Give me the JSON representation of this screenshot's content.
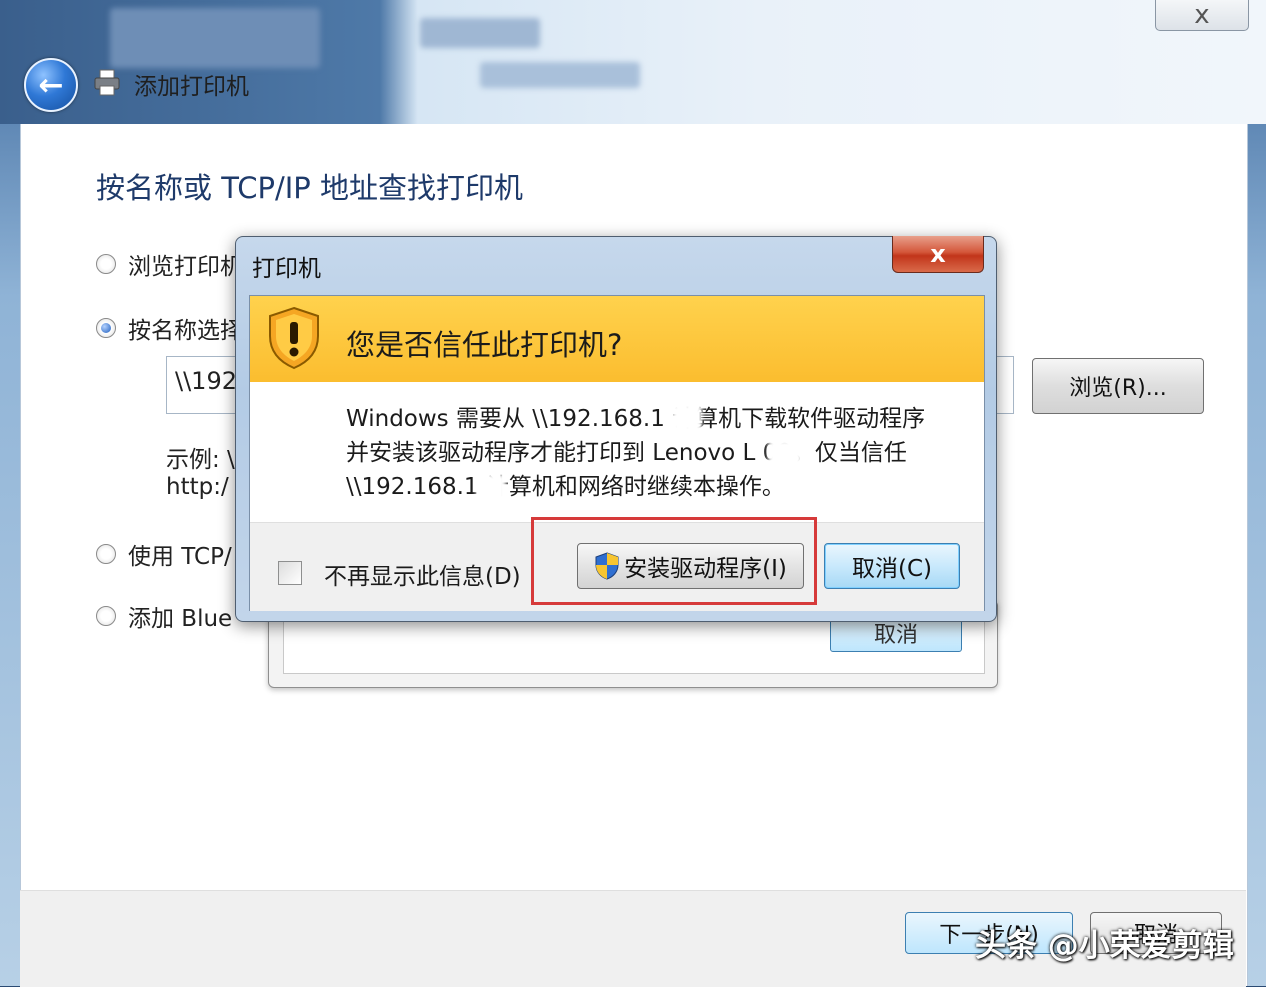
{
  "wizard": {
    "title": "添加打印机",
    "heading": "按名称或 TCP/IP 地址查找打印机",
    "options": [
      {
        "label": "浏览打印机",
        "selected": false
      },
      {
        "label": "按名称选择",
        "selected": true
      },
      {
        "label": "使用 TCP/",
        "selected": false
      },
      {
        "label": "添加 Blue",
        "selected": false
      }
    ],
    "path_value": "\\\\192",
    "example_line1": "示例: \\",
    "example_line2": "http:/",
    "browse_label": "浏览(R)...",
    "next_label": "下一步(N)",
    "cancel_label": "取消"
  },
  "progress_dialog": {
    "cancel_label": "取消"
  },
  "security_dialog": {
    "title": "打印机",
    "close_symbol": "x",
    "question": "您是否信任此打印机?",
    "message_lines": [
      "Windows 需要从 \\\\192.168.1      计算机下载软件驱动程序",
      "并安装该驱动程序才能打印到 Lenovo L     00。仅当信任",
      "\\\\192.168.1       计算机和网络时继续本操作。"
    ],
    "checkbox_label": "不再显示此信息(D)",
    "install_label": "安装驱动程序(I)",
    "cancel_label": "取消(C)"
  },
  "top_close_symbol": "x",
  "watermark": "头条 @小荣爱剪辑",
  "colors": {
    "warning_banner": "#fbbd2f",
    "highlight_box": "#d63a3a",
    "heading_text": "#1e3a6a"
  }
}
